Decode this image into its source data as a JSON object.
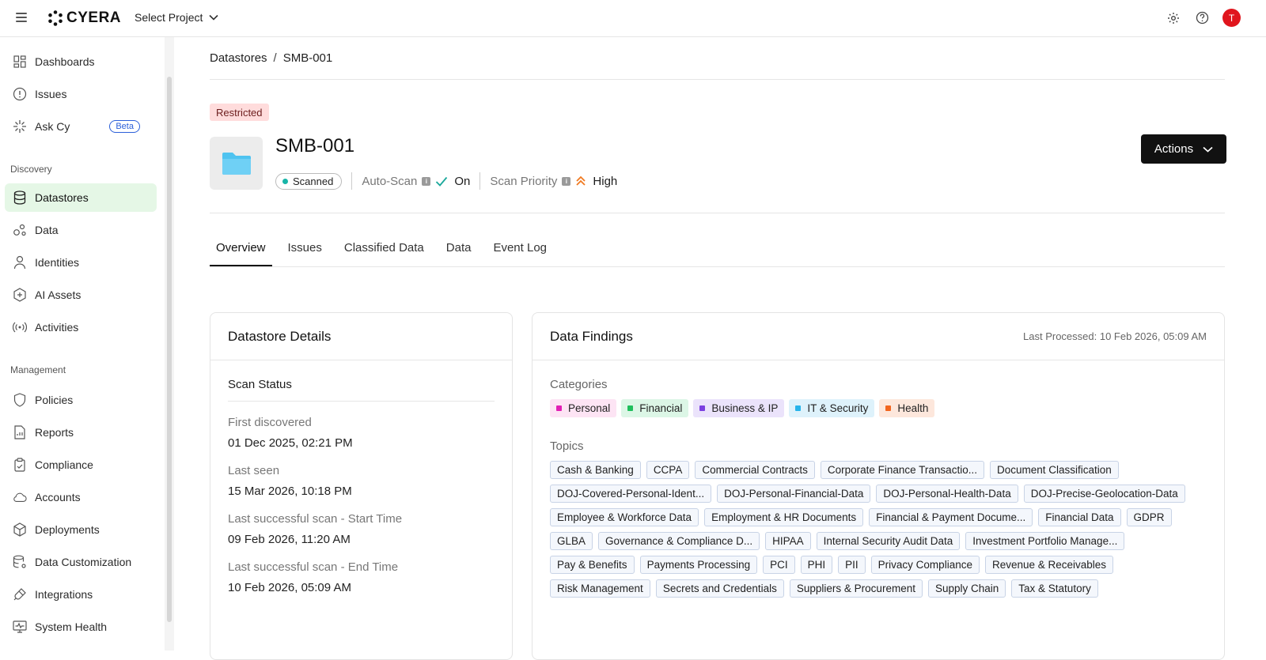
{
  "app": {
    "brand": "CYERA",
    "select_project": "Select Project",
    "avatar_initial": "T"
  },
  "sidebar": {
    "top_items": [
      {
        "label": "Dashboards",
        "icon": "grid-icon"
      },
      {
        "label": "Issues",
        "icon": "alert-circle-icon"
      },
      {
        "label": "Ask Cy",
        "icon": "sparkle-icon",
        "badge": "Beta"
      }
    ],
    "discovery_label": "Discovery",
    "discovery_items": [
      {
        "label": "Datastores",
        "icon": "database-icon",
        "active": true
      },
      {
        "label": "Data",
        "icon": "data-icon"
      },
      {
        "label": "Identities",
        "icon": "user-icon"
      },
      {
        "label": "AI Assets",
        "icon": "ai-icon"
      },
      {
        "label": "Activities",
        "icon": "activity-icon"
      }
    ],
    "management_label": "Management",
    "management_items": [
      {
        "label": "Policies",
        "icon": "shield-icon"
      },
      {
        "label": "Reports",
        "icon": "report-icon"
      },
      {
        "label": "Compliance",
        "icon": "clipboard-icon"
      },
      {
        "label": "Accounts",
        "icon": "cloud-icon"
      },
      {
        "label": "Deployments",
        "icon": "box-icon"
      },
      {
        "label": "Data Customization",
        "icon": "db-settings-icon"
      },
      {
        "label": "Integrations",
        "icon": "plug-icon"
      },
      {
        "label": "System Health",
        "icon": "monitor-icon"
      }
    ]
  },
  "breadcrumb": {
    "parent": "Datastores",
    "sep": "/",
    "current": "SMB-001"
  },
  "datastore": {
    "tag": "Restricted",
    "name": "SMB-001",
    "scan_state": "Scanned",
    "auto_scan_label": "Auto-Scan",
    "auto_scan_value": "On",
    "priority_label": "Scan Priority",
    "priority_value": "High"
  },
  "actions_label": "Actions",
  "tabs": [
    "Overview",
    "Issues",
    "Classified Data",
    "Data",
    "Event Log"
  ],
  "details": {
    "title": "Datastore Details",
    "scan_status": "Scan Status",
    "rows": [
      {
        "label": "First discovered",
        "value": "01 Dec 2025, 02:21 PM"
      },
      {
        "label": "Last seen",
        "value": "15 Mar 2026, 10:18 PM"
      },
      {
        "label": "Last successful scan - Start Time",
        "value": "09 Feb 2026, 11:20 AM"
      },
      {
        "label": "Last successful scan - End Time",
        "value": "10 Feb 2026, 05:09 AM"
      }
    ]
  },
  "findings": {
    "title": "Data Findings",
    "last_processed": "Last Processed: 10 Feb 2026, 05:09 AM",
    "categories_label": "Categories",
    "categories": [
      {
        "label": "Personal",
        "bg": "#fde4f4",
        "color": "#e21fb5"
      },
      {
        "label": "Financial",
        "bg": "#dcf6e6",
        "color": "#1fbf5c"
      },
      {
        "label": "Business & IP",
        "bg": "#ebe3fb",
        "color": "#7b3fe0"
      },
      {
        "label": "IT & Security",
        "bg": "#def2fb",
        "color": "#27b4ea"
      },
      {
        "label": "Health",
        "bg": "#fde7dc",
        "color": "#f2651f"
      }
    ],
    "topics_label": "Topics",
    "topics": [
      "Cash & Banking",
      "CCPA",
      "Commercial Contracts",
      "Corporate Finance Transactio...",
      "Document Classification",
      "DOJ-Covered-Personal-Ident...",
      "DOJ-Personal-Financial-Data",
      "DOJ-Personal-Health-Data",
      "DOJ-Precise-Geolocation-Data",
      "Employee & Workforce Data",
      "Employment & HR Documents",
      "Financial & Payment Docume...",
      "Financial Data",
      "GDPR",
      "GLBA",
      "Governance & Compliance D...",
      "HIPAA",
      "Internal Security Audit Data",
      "Investment Portfolio Manage...",
      "Pay & Benefits",
      "Payments Processing",
      "PCI",
      "PHI",
      "PII",
      "Privacy Compliance",
      "Revenue & Receivables",
      "Risk Management",
      "Secrets and Credentials",
      "Suppliers & Procurement",
      "Supply Chain",
      "Tax & Statutory"
    ]
  }
}
